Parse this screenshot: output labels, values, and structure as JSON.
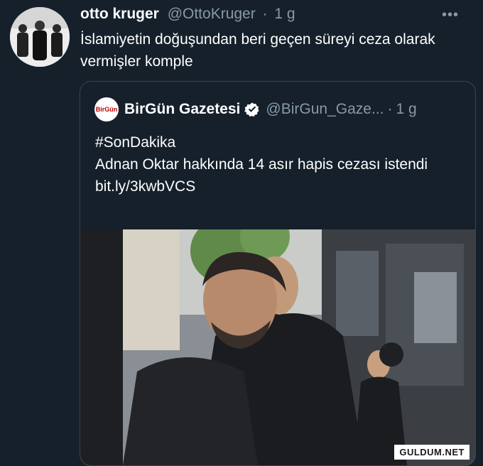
{
  "tweet": {
    "author_name": "otto kruger",
    "author_handle": "@OttoKruger",
    "separator": "·",
    "time": "1 g",
    "more_icon": "more-icon",
    "text": "İslamiyetin doğuşundan beri geçen süreyi ceza olarak vermişler komple"
  },
  "quote": {
    "author_name": "BirGün Gazetesi",
    "logo_text": "BirGün",
    "verified_icon": "verified-badge-icon",
    "author_handle": "@BirGun_Gaze...",
    "separator": "·",
    "time": "1 g",
    "lines": [
      "#SonDakika",
      "Adnan Oktar hakkında 14 asır hapis cezası istendi",
      "bit.ly/3kwbVCS"
    ]
  },
  "watermark": "GULDUM.NET",
  "colors": {
    "background": "#15202b",
    "secondary_text": "#8899a6",
    "border": "#38444d",
    "verified_badge": "#ffffff"
  }
}
